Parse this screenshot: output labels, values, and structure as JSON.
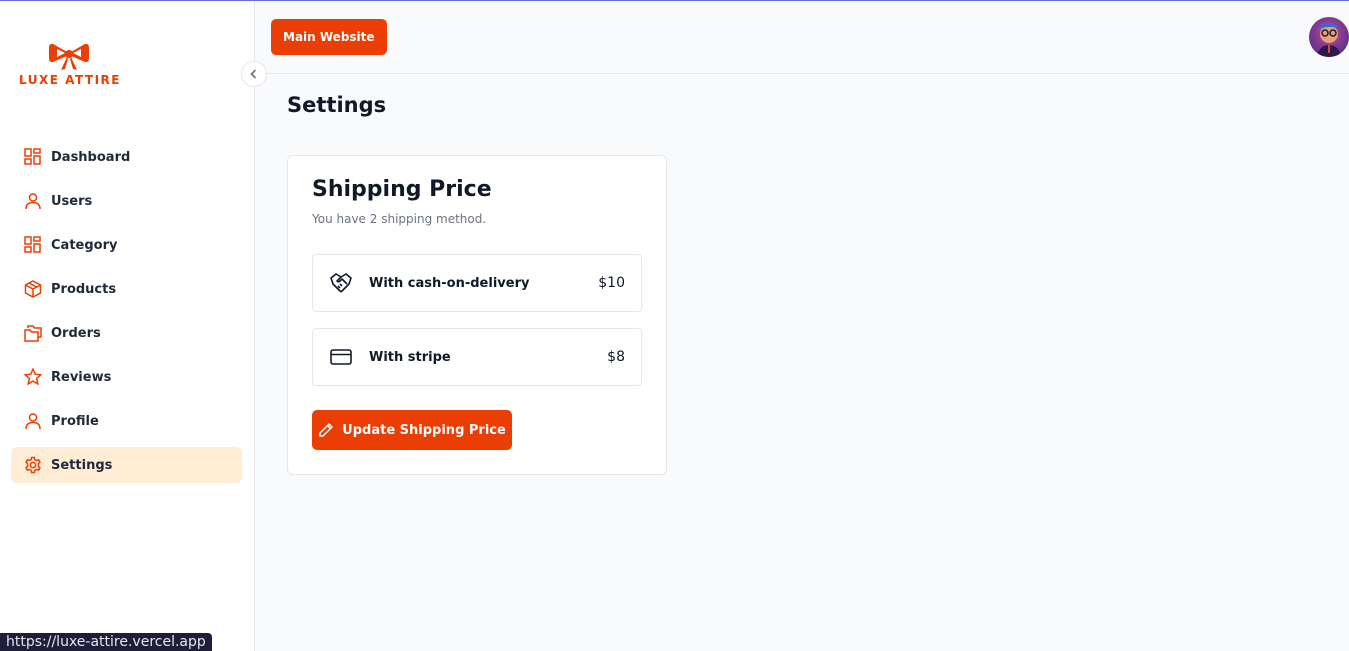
{
  "brand": {
    "name": "LUXE ATTIRE",
    "color": "#ea3e05"
  },
  "sidebar": {
    "items": [
      {
        "label": "Dashboard",
        "icon": "grid-icon"
      },
      {
        "label": "Users",
        "icon": "user-icon"
      },
      {
        "label": "Category",
        "icon": "grid-icon"
      },
      {
        "label": "Products",
        "icon": "box-icon"
      },
      {
        "label": "Orders",
        "icon": "folders-icon"
      },
      {
        "label": "Reviews",
        "icon": "star-icon"
      },
      {
        "label": "Profile",
        "icon": "user-icon"
      },
      {
        "label": "Settings",
        "icon": "gear-icon",
        "active": true
      }
    ]
  },
  "header": {
    "main_website_label": "Main Website"
  },
  "page": {
    "title": "Settings"
  },
  "shipping": {
    "title": "Shipping Price",
    "subtitle": "You have 2 shipping method.",
    "methods": [
      {
        "label": "With cash-on-delivery",
        "price": "$10",
        "icon": "handshake-icon"
      },
      {
        "label": "With stripe",
        "price": "$8",
        "icon": "credit-card-icon"
      }
    ],
    "update_label": "Update Shipping Price"
  },
  "status_bar": {
    "url": "https://luxe-attire.vercel.app"
  }
}
